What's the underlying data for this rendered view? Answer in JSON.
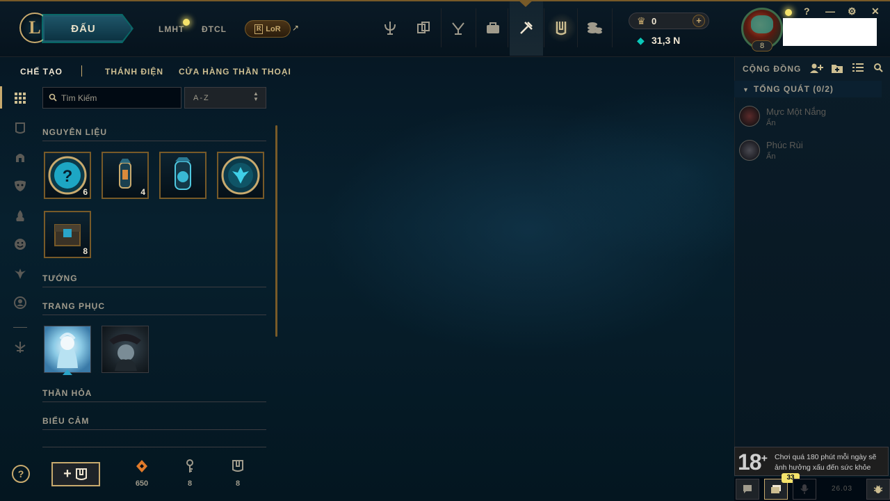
{
  "topbar": {
    "play_label": "ĐẤU",
    "nav_links": [
      "LMHT",
      "ĐTCL"
    ],
    "lor_label": "LoR",
    "lor_glyph": "R",
    "external_glyph": "↗",
    "rp_value": "0",
    "be_value": "31,3 N",
    "nav_icons": [
      "home-icon",
      "tft-icon",
      "clash-icon",
      "store-icon",
      "crafting-icon",
      "collection-icon",
      "loot-icon"
    ]
  },
  "profile": {
    "level": "8",
    "window_controls": [
      "?",
      "—",
      "⚙",
      "✕"
    ]
  },
  "subnav": {
    "tabs": [
      "CHẾ TẠO",
      "THÁNH ĐIỆN",
      "CỬA HÀNG THẦN THOẠI"
    ]
  },
  "filters": {
    "search_placeholder": "Tìm Kiếm",
    "sort_value": "A-Z"
  },
  "sections": {
    "materials": "NGUYÊN LIỆU",
    "champions": "TƯỚNG",
    "skins": "TRANG PHỤC",
    "wards": "THẦN HỎA",
    "emotes": "BIỂU CẢM"
  },
  "materials": [
    {
      "icon": "mystery-orb-icon",
      "count": "6"
    },
    {
      "icon": "capsule-icon",
      "count": "4"
    },
    {
      "icon": "hextech-capsule-icon",
      "count": ""
    },
    {
      "icon": "mythic-emblem-icon",
      "count": ""
    },
    {
      "icon": "hextech-chest-icon",
      "count": "8"
    }
  ],
  "skins": [
    {
      "icon": "skin-ice-icon"
    },
    {
      "icon": "skin-dark-icon"
    }
  ],
  "bottom": {
    "orange_essence": "650",
    "keys": "8",
    "chests": "8",
    "add_glyph": "+"
  },
  "social": {
    "title": "CỘNG ĐỒNG",
    "group_label": "TỔNG QUÁT (0/2)",
    "friends": [
      {
        "name": "Mực Một Nắng",
        "status": "Ẩn"
      },
      {
        "name": "Phúc Rùi",
        "status": "Ẩn"
      }
    ]
  },
  "age_warning": {
    "rating": "18",
    "plus": "+",
    "text": "Chơi quá 180 phút mỗi ngày sẽ ảnh hưởng xấu đến sức khỏe"
  },
  "bottom_bar": {
    "badge_count": "33",
    "version": "26.03"
  },
  "colors": {
    "gold": "#c8aa6e",
    "gold_dark": "#785a28",
    "teal": "#0ac8b9",
    "background": "#010a13"
  }
}
